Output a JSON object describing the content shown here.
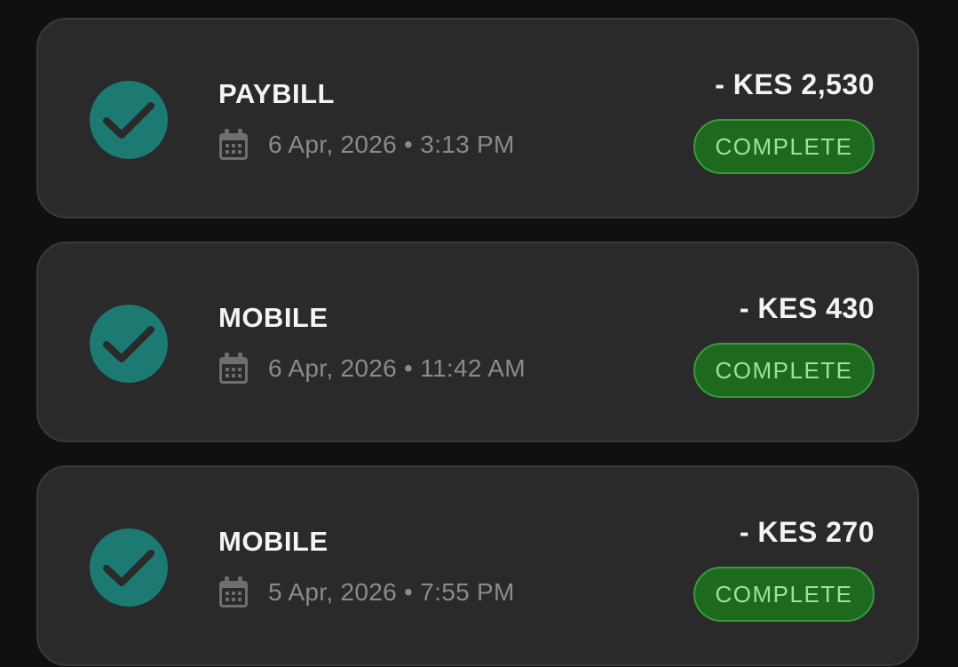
{
  "colors": {
    "background": "#101010",
    "card": "#2a2a2a",
    "status_circle": "#1c7a72",
    "badge_bg": "#1d6a1f",
    "badge_text": "#9de0a0"
  },
  "transactions": [
    {
      "type": "PAYBILL",
      "datetime": "6 Apr, 2026 • 3:13 PM",
      "amount": "- KES 2,530",
      "status": "COMPLETE",
      "status_icon": "check-icon",
      "date_icon": "calendar-icon"
    },
    {
      "type": "MOBILE",
      "datetime": "6 Apr, 2026 • 11:42 AM",
      "amount": "- KES 430",
      "status": "COMPLETE",
      "status_icon": "check-icon",
      "date_icon": "calendar-icon"
    },
    {
      "type": "MOBILE",
      "datetime": "5 Apr, 2026 • 7:55 PM",
      "amount": "- KES 270",
      "status": "COMPLETE",
      "status_icon": "check-icon",
      "date_icon": "calendar-icon"
    }
  ]
}
